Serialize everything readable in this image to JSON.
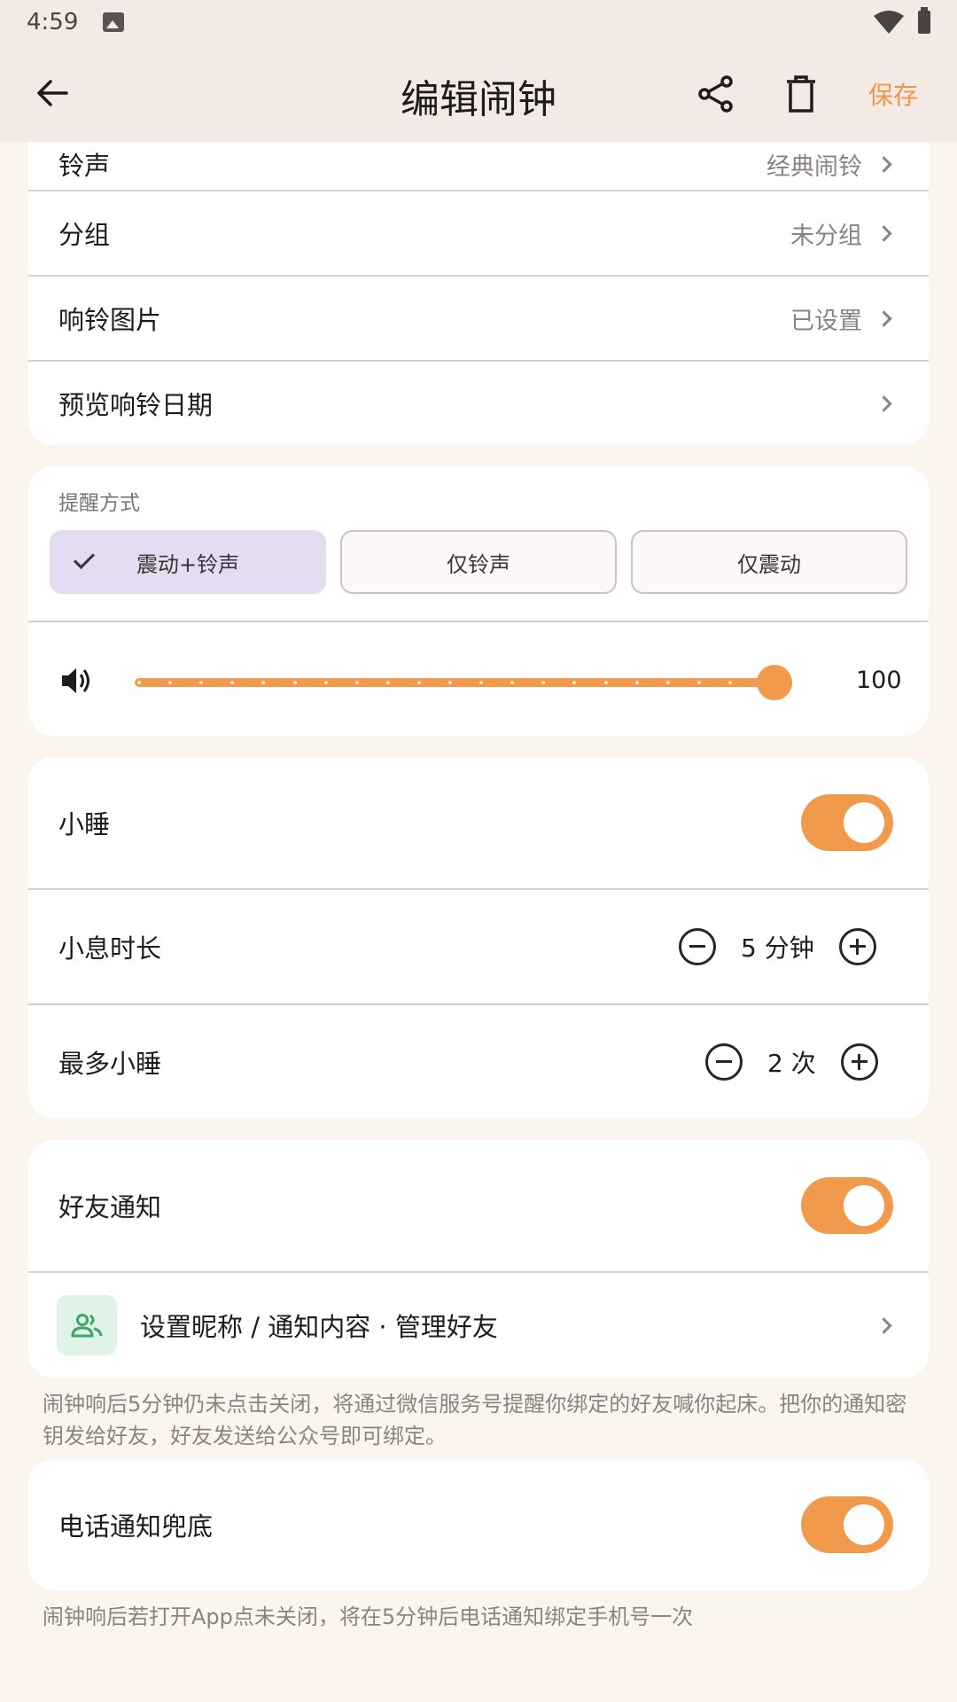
{
  "status_bar": {
    "time": "4:59"
  },
  "header": {
    "title": "编辑闹钟",
    "save_label": "保存"
  },
  "settings_rows": [
    {
      "label": "铃声",
      "value": "经典闹铃"
    },
    {
      "label": "分组",
      "value": "未分组"
    },
    {
      "label": "响铃图片",
      "value": "已设置"
    },
    {
      "label": "预览响铃日期",
      "value": ""
    }
  ],
  "reminder": {
    "title": "提醒方式",
    "options": [
      "震动+铃声",
      "仅铃声",
      "仅震动"
    ],
    "selected": "震动+铃声",
    "volume": 100,
    "volume_label": "100"
  },
  "snooze": {
    "label": "小睡",
    "enabled": true,
    "duration_label": "小息时长",
    "duration_value": "5 分钟",
    "max_label": "最多小睡",
    "max_value": "2 次"
  },
  "friend_notify": {
    "label": "好友通知",
    "enabled": true,
    "manage_label": "设置昵称 / 通知内容 · 管理好友",
    "hint": "闹钟响后5分钟仍未点击关闭，将通过微信服务号提醒你绑定的好友喊你起床。把你的通知密钥发给好友，好友发送给公众号即可绑定。"
  },
  "phone_notify": {
    "label": "电话通知兜底",
    "enabled": true,
    "hint": "闹钟响后若打开App点未关闭，将在5分钟后电话通知绑定手机号一次"
  },
  "colors": {
    "accent": "#f19a4b",
    "selected_segment": "#e4dcf0",
    "friend_icon_bg": "#dff3e6",
    "friend_icon": "#3aa865"
  }
}
